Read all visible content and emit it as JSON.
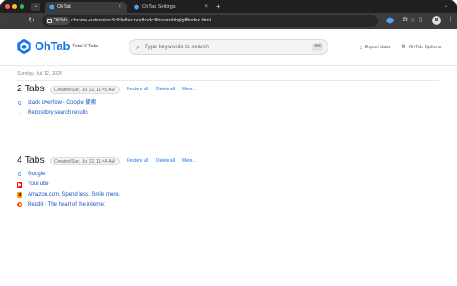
{
  "browser": {
    "tabs": [
      {
        "label": "OhTab",
        "close": "×"
      },
      {
        "label": "OhTab Settings",
        "close": "×"
      }
    ],
    "tab_dropdown": "⌄",
    "new_tab": "+",
    "url_chip": "OhTab",
    "url": "chrome-extension://clbfelhkcojodbodcdlhnomabbglgfl/index.html",
    "profile_initial": "M"
  },
  "header": {
    "logo": "OhTab",
    "total": "Total 6 Tabs",
    "search_placeholder": "Type keywords to search",
    "search_shortcut": "⌘K",
    "export_label": "Export data",
    "options_label": "OhTab Options"
  },
  "content": {
    "date": "Sunday, Jul 12, 2026",
    "groups": [
      {
        "title": "2 Tabs",
        "created": "Created Sun, Jul 12, 11:45 AM",
        "restore": "Restore all",
        "delete": "Delete all",
        "more": "More...",
        "tabs": [
          {
            "icon": "google-icon",
            "label": "stack overflow - Google 搜索"
          },
          {
            "icon": "github-icon",
            "label": "Repository search results"
          }
        ]
      },
      {
        "title": "4 Tabs",
        "created": "Created Sun, Jul 12, 11:44 AM",
        "restore": "Restore all",
        "delete": "Delete all",
        "more": "More...",
        "tabs": [
          {
            "icon": "google-icon",
            "label": "Google"
          },
          {
            "icon": "youtube-icon",
            "label": "YouTube"
          },
          {
            "icon": "amazon-icon",
            "label": "Amazon.com. Spend less. Smile more."
          },
          {
            "icon": "reddit-icon",
            "label": "Reddit - The heart of the internet"
          }
        ]
      }
    ]
  },
  "colors": {
    "accent": "#1a73e8",
    "link": "#1a56c4",
    "chrome_dark": "#1f1f1f"
  }
}
